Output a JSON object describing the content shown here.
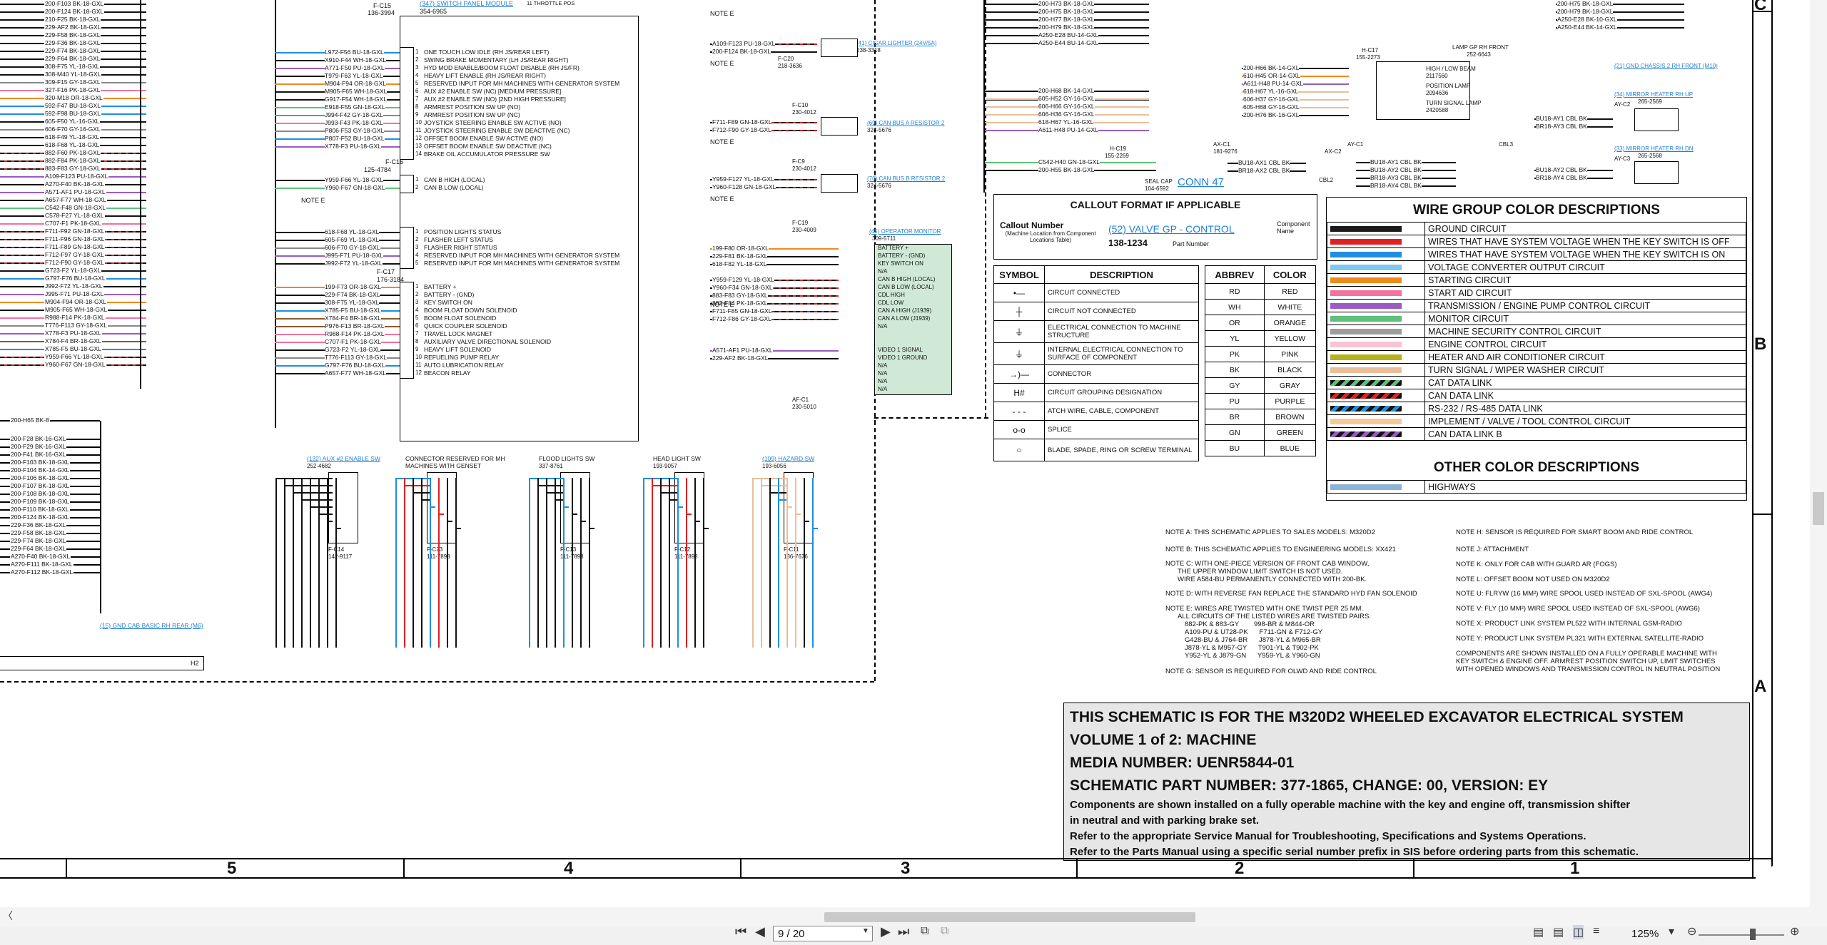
{
  "document": {
    "wire_list_left": [
      "200-F103 BK-18-GXL",
      "200-F124 BK-18-GXL",
      "210-F25 BK-18-GXL",
      "229-AF2 BK-18-GXL",
      "229-F58 BK-18-GXL",
      "229-F36 BK-18-GXL",
      "229-F74 BK-18-GXL",
      "229-F64 BK-18-GXL",
      "308-F75 YL-18-GXL",
      "308-M40 YL-18-GXL",
      "309-F15 GY-18-GXL",
      "327-F16 PK-18-GXL",
      "320-M18 OR-18-GXL",
      "592-F47 BU-18-GXL",
      "592-F98 BU-18-GXL",
      "605-F50 YL-16-GXL",
      "606-F70 GY-16-GXL",
      "618-F49 YL-18-GXL",
      "618-F68 YL-18-GXL",
      "882-F60 PK-18-GXL",
      "882-F84 PK-18-GXL",
      "883-F83 GY-18-GXL",
      "A109-F123 PU-18-GXL",
      "A270-F40 BK-18-GXL",
      "A571-AF1 PU-18-GXL",
      "A657-F77 WH-18-GXL",
      "C542-F48 GN-18-GXL",
      "C578-F27 YL-18-GXL",
      "C707-F1 PK-18-GXL",
      "F711-F92 GN-18-GXL",
      "F711-F96 GN-18-GXL",
      "F711-F89 GN-18-GXL",
      "F712-F97 GY-18-GXL",
      "F712-F90 GY-18-GXL",
      "G723-F2 YL-18-GXL",
      "G797-F76 BU-18-GXL",
      "J992-F72 YL-18-GXL",
      "J995-F71 PU-18-GXL",
      "M904-F94 OR-18-GXL",
      "M905-F65 WH-18-GXL",
      "R988-F14 PK-18-GXL",
      "T776-F113 GY-18-GXL",
      "X778-F3 PU-18-GXL",
      "X784-F4 BR-18-GXL",
      "X785-F5 BU-18-GXL",
      "Y959-F66 YL-18-GXL",
      "Y960-F67 GN-18-GXL"
    ],
    "wire_list_left2": [
      "200-H65 BK-8",
      "200-F28 BK-16-GXL",
      "200-F29 BK-16-GXL",
      "200-F41 BK-16-GXL",
      "200-F103 BK-18-GXL",
      "200-F104 BK-14-GXL",
      "200-F106 BK-18-GXL",
      "200-F107 BK-18-GXL",
      "200-F108 BK-18-GXL",
      "200-F109 BK-18-GXL",
      "200-F110 BK-18-GXL",
      "200-F124 BK-18-GXL",
      "229-F36 BK-18-GXL",
      "229-F58 BK-18-GXL",
      "229-F74 BK-18-GXL",
      "229-F64 BK-18-GXL",
      "A270-F40 BK-18-GXL",
      "A270-F111 BK-18-GXL",
      "A270-F112 BK-18-GXL"
    ],
    "c15_label": "F-C15",
    "c15_pn": "136-3994",
    "switch_panel_link": "(347) SWITCH PANEL MODULE",
    "switch_panel_pn": "354-6965",
    "throttle_pos": "11 THROTTLE POS",
    "switch_panel_wires": [
      "L972-F56 BU-18-GXL",
      "X910-F44 WH-18-GXL",
      "A771-F50 PU-18-GXL",
      "T979-F63 YL-18-GXL",
      "M904-F94 OR-18-GXL",
      "M905-F65 WH-18-GXL",
      "G917-F54 WH-18-GXL",
      "E918-F55 GN-18-GXL",
      "J994-F42 GY-18-GXL",
      "J993-F43 PK-18-GXL",
      "P806-F53 GY-18-GXL",
      "P807-F52 BU-18-GXL",
      "X778-F3 PU-18-GXL"
    ],
    "switch_panel_funcs": [
      "ONE TOUCH LOW IDLE (RH JS/REAR LEFT)",
      "SWING BRAKE MOMENTARY (LH JS/REAR RIGHT)",
      "HYD MOD ENABLE/BOOM FLOAT DISABLE (RH JS/FR)",
      "HEAVY LIFT ENABLE (RH JS/REAR RIGHT)",
      "RESERVED INPUT FOR MH MACHINES WITH GENERATOR SYSTEM",
      "AUX #2 ENABLE SW (NC) [MEDIUM PRESSURE]",
      "AUX #2 ENABLE SW (NO) [2ND HIGH PRESSURE]",
      "ARMREST POSITION SW UP (NO)",
      "ARMREST POSITION SW UP (NC)",
      "JOYSTICK STEERING ENABLE SW ACTIVE (NO)",
      "JOYSTICK STEERING ENABLE SW DEACTIVE (NC)",
      "OFFSET BOOM ENABLE SW ACTIVE (NO)",
      "OFFSET BOOM ENABLE SW DEACTIVE (NC)",
      "BRAKE OIL ACCUMULATOR PRESSURE SW"
    ],
    "c16_label": "F-C16",
    "c16_pn": "125-4784",
    "can_wires": [
      "Y959-F66 YL-18-GXL",
      "Y960-F67 GN-18-GXL"
    ],
    "can_funcs": [
      "CAN B HIGH (LOCAL)",
      "CAN B LOW (LOCAL)"
    ],
    "note_e": "NOTE E",
    "c17_label": "F-C17",
    "c17_pn": "176-3184",
    "status_wires": [
      "618-F68 YL-18-GXL",
      "605-F69 YL-18-GXL",
      "606-F70 GY-18-GXL",
      "J995-F71 PU-18-GXL",
      "J992-F72 YL-18-GXL"
    ],
    "status_funcs": [
      "POSITION LIGHTS STATUS",
      "FLASHER LEFT STATUS",
      "FLASHER RIGHT STATUS",
      "RESERVED INPUT FOR MH MACHINES WITH GENERATOR SYSTEM",
      "RESERVED INPUT FOR MH MACHINES WITH GENERATOR SYSTEM"
    ],
    "batt_wires": [
      "199-F73 OR-18-GXL",
      "229-F74 BK-18-GXL",
      "308-F75 YL-18-GXL",
      "X785-F5 BU-18-GXL",
      "X784-F4 BR-18-GXL",
      "P976-F13 BR-18-GXL",
      "R988-F14 PK-18-GXL",
      "C707-F1 PK-18-GXL",
      "G723-F2 YL-18-GXL",
      "T776-F113 GY-18-GXL",
      "G797-F76 BU-18-GXL",
      "A657-F77 WH-18-GXL"
    ],
    "batt_funcs": [
      "BATTERY +",
      "BATTERY - (GND)",
      "KEY SWITCH ON",
      "BOOM FLOAT DOWN SOLENOID",
      "BOOM FLOAT SOLENOID",
      "QUICK COUPLER SOLENOID",
      "TRAVEL LOCK MAGNET",
      "AUXILIARY VALVE DIRECTIONAL SOLENOID",
      "HEAVY LIFT SOLENOID",
      "REFUELING PUMP RELAY",
      "AUTO LUBRICATION RELAY",
      "BEACON RELAY"
    ],
    "cigar_link": "(41) CIGAR LIGHTER (24V/5A)",
    "cigar_pn": "238-3318",
    "c20_label": "F-C20",
    "c20_pn": "218-3636",
    "cigar_wires": [
      "A109-F123 PU-18-GXL",
      "200-F124 BK-18-GXL"
    ],
    "c10_label": "F-C10",
    "c10_pn": "230-4012",
    "can_res1_link": "(69) CAN BUS A RESISTOR 2",
    "can_res1_pn": "324-5676",
    "can_res1_wires": [
      "F711-F89 GN-18-GXL",
      "F712-F90 GY-18-GXL"
    ],
    "c9_label": "F-C9",
    "c9_pn": "230-4012",
    "can_res2_link": "(70) CAN BUS B RESISTOR 2",
    "can_res2_pn": "324-5676",
    "can_res2_wires": [
      "Y959-F127 YL-18-GXL",
      "Y960-F128 GN-18-GXL"
    ],
    "c19_label": "F-C19",
    "c19_pn": "230-4009",
    "monitor_link": "(45) OPERATOR MONITOR",
    "monitor_pn": "309-5711",
    "monitor_wires": [
      "199-F80 OR-18-GXL",
      "229-F81 BK-18-GXL",
      "618-F82 YL-18-GXL",
      "Y959-F129 YL-18-GXL",
      "Y960-F34 GN-18-GXL",
      "883-F83 GY-18-GXL",
      "882-F84 PK-18-GXL",
      "F711-F85 GN-18-GXL",
      "F712-F86 GY-18-GXL"
    ],
    "monitor_funcs": [
      "BATTERY +",
      "BATTERY - (GND)",
      "KEY SWITCH ON",
      "N/A",
      "CAN B HIGH (LOCAL)",
      "CAN B LOW (LOCAL)",
      "CDL HIGH",
      "CDL LOW",
      "CAN A HIGH (J1939)",
      "CAN A LOW (J1939)",
      "N/A"
    ],
    "video_wires": [
      "A571-AF1 PU-18-GXL",
      "229-AF2 BK-18-GXL"
    ],
    "video_funcs": [
      "VIDEO 1 SIGNAL",
      "VIDEO 1 GROUND",
      "N/A",
      "N/A",
      "N/A",
      "N/A"
    ],
    "af_c1": "AF-C1",
    "af_c1_pn": "230-5010",
    "bottom_switches": [
      {
        "link": "(132) AUX #2 ENABLE SW",
        "pn": "252-4682",
        "conn": "F-C14",
        "conn_pn": "142-9117"
      },
      {
        "link": "CONNECTOR RESERVED FOR MH MACHINES WITH GENSET",
        "pn": "",
        "conn": "F-C23",
        "conn_pn": "111-7898"
      },
      {
        "link": "FLOOD LIGHTS SW",
        "pn": "337-8761",
        "conn": "F-C13",
        "conn_pn": "111-7898"
      },
      {
        "link": "HEAD LIGHT SW",
        "pn": "193-9057",
        "conn": "F-C12",
        "conn_pn": "111-7898"
      },
      {
        "link": "(109) HAZARD SW",
        "pn": "193-6056",
        "conn": "F-C11",
        "conn_pn": "136-7676"
      }
    ],
    "gnd_link": "(15) GND CAB BASIC RH REAR (M6)",
    "h2": "H2",
    "right_wires_a": [
      "200-H73 BK-18-GXL",
      "200-H75 BK-18-GXL",
      "200-H77 BK-18-GXL",
      "200-H79 BK-18-GXL",
      "A250-E28 BU-14-GXL",
      "A250-E44 BU-14-GXL",
      "200-H68 BK-14-GXL"
    ],
    "right_wires_b": [
      "200-H75 BK-18-GXL",
      "200-H79 BK-18-GXL",
      "A250-E28 BK-10-GXL",
      "A250-E44 BK-14-GXL"
    ],
    "chassis_gnd_link": "(21) GND CHASSIS 2 RH FRONT (M10)",
    "lamp_label": "LAMP GP RH FRONT",
    "lamp_pn": "252-6643",
    "h17_label": "H-C17",
    "h17_pn": "155-2273",
    "lamp_wires": [
      "200-H66 BK-14-GXL",
      "610-H45 OR-14-GXL",
      "A611-H48 PU-14-GXL",
      "618-H67 YL-16-GXL",
      "606-H37 GY-16-GXL",
      "605-H68 GY-16-GXL",
      "200-H76 BK-16-GXL"
    ],
    "lamp_funcs": [
      "HIGH / LOW BEAM",
      "POSITION LAMP",
      "TURN SIGNAL LAMP"
    ],
    "lamp_pns": [
      "2117560",
      "2094636",
      "2420588"
    ],
    "left_lamp_wires": [
      "200-H68 BK-14-GXL",
      "605-H52 GY-16-GXL",
      "606-H66 GY-16-GXL",
      "606-H36 GY-16-GXL",
      "618-H67 YL-16-GXL",
      "A611-H48 PU-14-GXL"
    ],
    "mirror_up_link": "(34) MIRROR HEATER RH UP",
    "mirror_up_pn": "265-2569",
    "mirror_dn_link": "(33) MIRROR HEATER RH DN",
    "mirror_dn_pn": "265-2568",
    "mirror_wires_up": [
      "BU18-AY1 CBL BK",
      "BR18-AY3 CBL BK"
    ],
    "mirror_wires_dn": [
      "BU18-AY2 CBL BK",
      "BR18-AY4 CBL BK"
    ],
    "cbl3_wires": [
      "BU18-AY1 CBL BK",
      "BU18-AY2 CBL BK",
      "BR18-AY3 CBL BK",
      "BR18-AY4 CBL BK"
    ],
    "ax_c1": "AX-C1",
    "ax_c1_pn": "181-9276",
    "ax_c2": "AX-C2",
    "ay_c1": "AY-C1",
    "ay_c2": "AY-C2",
    "ay_c3": "AY-C3",
    "cbl2": "CBL2",
    "cbl3": "CBL3",
    "h19_label": "H-C19",
    "h19_pn": "155-2269",
    "seal_cap": "SEAL CAP",
    "seal_cap_pn": "104-6592",
    "seal_wires": [
      "C542-H40 GN-18-GXL",
      "200-H55 BK-18-GXL"
    ],
    "ax_wires": [
      "BU18-AX1 CBL BK",
      "BR18-AX2 CBL BK"
    ],
    "conn47": "CONN 47",
    "callout_title": "CALLOUT FORMAT IF APPLICABLE",
    "callout_number": "Callout Number",
    "callout_number_sub": "(Machine Location from Component Locations Table)",
    "callout_example": "(52) VALVE GP - CONTROL",
    "callout_pn": "138-1234",
    "callout_component": "Component Name",
    "callout_partnum": "Part Number",
    "symbol_header": "SYMBOL",
    "desc_header": "DESCRIPTION",
    "symbols": [
      {
        "icon": "connected-dot",
        "desc": "CIRCUIT CONNECTED"
      },
      {
        "icon": "cross",
        "desc": "CIRCUIT NOT CONNECTED"
      },
      {
        "icon": "ground",
        "desc": "ELECTRICAL CONNECTION TO MACHINE STRUCTURE"
      },
      {
        "icon": "component-ground",
        "desc": "INTERNAL ELECTRICAL CONNECTION TO SURFACE OF COMPONENT"
      },
      {
        "icon": "connector",
        "desc": "CONNECTOR"
      },
      {
        "icon": "hash",
        "desc": "CIRCUIT GROUPING DESIGNATION"
      },
      {
        "icon": "dashed",
        "desc": "ATCH WIRE, CABLE, COMPONENT"
      },
      {
        "icon": "splice",
        "desc": "SPLICE"
      },
      {
        "icon": "terminal",
        "desc": "BLADE, SPADE, RING OR SCREW TERMINAL"
      }
    ],
    "abbrev_header": "ABBREV",
    "color_header": "COLOR",
    "abbrevs": [
      [
        "RD",
        "RED"
      ],
      [
        "WH",
        "WHITE"
      ],
      [
        "OR",
        "ORANGE"
      ],
      [
        "YL",
        "YELLOW"
      ],
      [
        "PK",
        "PINK"
      ],
      [
        "BK",
        "BLACK"
      ],
      [
        "GY",
        "GRAY"
      ],
      [
        "PU",
        "PURPLE"
      ],
      [
        "BR",
        "BROWN"
      ],
      [
        "GN",
        "GREEN"
      ],
      [
        "BU",
        "BLUE"
      ]
    ],
    "wire_group_title": "WIRE GROUP COLOR DESCRIPTIONS",
    "wire_groups": [
      {
        "color": "#1a1a1a",
        "label": "GROUND CIRCUIT"
      },
      {
        "color": "#e02020",
        "label": "WIRES THAT HAVE SYSTEM VOLTAGE WHEN THE KEY SWITCH IS OFF"
      },
      {
        "color": "#1e8ee0",
        "label": "WIRES THAT HAVE SYSTEM VOLTAGE WHEN THE KEY SWITCH IS ON"
      },
      {
        "color": "#7ec8ef",
        "label": "VOLTAGE CONVERTER OUTPUT CIRCUIT"
      },
      {
        "color": "#f08a1c",
        "label": "STARTING CIRCUIT"
      },
      {
        "color": "#f2739b",
        "label": "START AID CIRCUIT"
      },
      {
        "color": "#9a5bc4",
        "label": "TRANSMISSION / ENGINE PUMP CONTROL CIRCUIT"
      },
      {
        "color": "#5fc07a",
        "label": "MONITOR CIRCUIT"
      },
      {
        "color": "#9c9c9c",
        "label": "MACHINE SECURITY CONTROL CIRCUIT"
      },
      {
        "color": "#f8c3d4",
        "label": "ENGINE CONTROL CIRCUIT"
      },
      {
        "color": "#b5b21a",
        "label": "HEATER AND AIR CONDITIONER CIRCUIT"
      },
      {
        "color": "#e9bf9a",
        "label": "TURN SIGNAL / WIPER WASHER CIRCUIT"
      },
      {
        "color": "stripe-green",
        "label": "CAT DATA LINK"
      },
      {
        "color": "stripe-red",
        "label": "CAN DATA LINK"
      },
      {
        "color": "stripe-blue",
        "label": "RS-232 / RS-485 DATA LINK"
      },
      {
        "color": "#f5c89a",
        "label": "IMPLEMENT / VALVE / TOOL CONTROL CIRCUIT"
      },
      {
        "color": "stripe-purple",
        "label": "CAN DATA LINK B"
      }
    ],
    "other_title": "OTHER COLOR DESCRIPTIONS",
    "other": [
      {
        "color": "#8fb3d6",
        "label": "HIGHWAYS"
      }
    ],
    "notes_left": [
      "NOTE A: THIS SCHEMATIC APPLIES TO SALES MODELS: M320D2",
      "NOTE B: THIS SCHEMATIC APPLIES TO ENGINEERING MODELS: XX421",
      "NOTE C: WITH ONE-PIECE VERSION OF FRONT CAB WINDOW,",
      "THE UPPER WINDOW LIMIT SWITCH IS NOT USED.",
      "WIRE A584-BU PERMANENTLY CONNECTED WITH 200-BK.",
      "NOTE D: WITH REVERSE FAN REPLACE THE STANDARD HYD FAN SOLENOID",
      "NOTE E: WIRES ARE TWISTED WITH ONE TWIST PER 25 MM.",
      "ALL CIRCUITS OF THE LISTED WIRES ARE TWISTED PAIRS.",
      "882-PK & 883-GY        998-BR & M844-OR",
      "A109-PU & U728-PK      F711-GN & F712-GY",
      "G428-BU & J764-BR      J878-YL & M965-BR",
      "J878-YL & M957-GY      T901-YL & T902-PK",
      "Y952-YL & J879-GN      Y959-YL & Y960-GN",
      "NOTE G: SENSOR IS REQUIRED FOR OLWD AND RIDE CONTROL"
    ],
    "notes_right": [
      "NOTE H: SENSOR IS REQUIRED FOR SMART BOOM AND RIDE CONTROL",
      "NOTE J: ATTACHMENT",
      "NOTE K: ONLY FOR CAB WITH GUARD AR (FOGS)",
      "NOTE L: OFFSET BOOM NOT USED ON M320D2",
      "NOTE U: FLRYW (16 MM²) WIRE SPOOL USED INSTEAD OF SXL-SPOOL (AWG4)",
      "NOTE V: FLY (10 MM²) WIRE SPOOL USED INSTEAD OF SXL-SPOOL (AWG6)",
      "NOTE X: PRODUCT LINK SYSTEM PL522 WITH INTERNAL GSM-RADIO",
      "NOTE Y: PRODUCT LINK SYSTEM PL321 WITH EXTERNAL SATELLITE-RADIO",
      "COMPONENTS ARE SHOWN INSTALLED ON A FULLY OPERABLE MACHINE WITH",
      "KEY SWITCH & ENGINE OFF. ARMREST POSITION SWITCH UP, LIMIT SWITCHES",
      "WITH OPENED WINDOWS AND TRANSMISSION CONTROL IN NEUTRAL POSITION"
    ],
    "title_lines": [
      "THIS SCHEMATIC IS FOR THE M320D2 WHEELED EXCAVATOR ELECTRICAL SYSTEM",
      "VOLUME 1 of 2: MACHINE",
      "MEDIA NUMBER: UENR5844-01",
      "SCHEMATIC PART NUMBER: 377-1865, CHANGE: 00, VERSION: EY"
    ],
    "title_small": [
      "Components are shown installed on a fully operable machine with the key and engine off, transmission shifter",
      "in neutral and with parking brake set.",
      "Refer to the appropriate Service Manual for Troubleshooting, Specifications and Systems Operations.",
      "Refer to the Parts Manual using a specific serial number prefix in SIS before ordering parts from this schematic."
    ],
    "zone_cols": [
      "5",
      "4",
      "3",
      "2",
      "1"
    ],
    "zone_rows": [
      "C",
      "B",
      "A"
    ]
  },
  "viewer": {
    "page_value": "9 / 20",
    "zoom": "125%"
  }
}
